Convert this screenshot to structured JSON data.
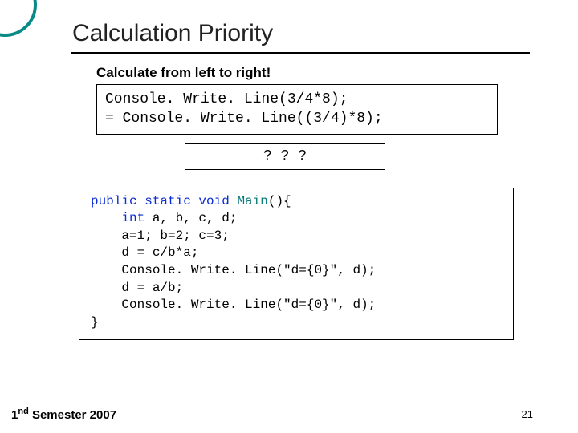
{
  "title": "Calculation Priority",
  "subtitle": "Calculate from left to right!",
  "box1": {
    "line1": "  Console. Write. Line(3/4*8);",
    "line2": "= Console. Write. Line((3/4)*8);"
  },
  "questionbox": "? ? ?",
  "box2": {
    "sig_pre": "public static void ",
    "sig_cls": "Main",
    "sig_post": "(){",
    "l_int_kw": "int",
    "l_int_rest": " a, b, c, d;",
    "l_assign": "    a=1; b=2; c=3;",
    "l_d1": "    d = c/b*a;",
    "l_cw1": "    Console. Write. Line(\"d={0}\", d);",
    "l_d2": "    d = a/b;",
    "l_cw2": "    Console. Write. Line(\"d={0}\", d);",
    "l_close": "}"
  },
  "footer": {
    "left_prefix": "1",
    "left_sup": "nd",
    "left_rest": " Semester 2007",
    "page": "21"
  }
}
